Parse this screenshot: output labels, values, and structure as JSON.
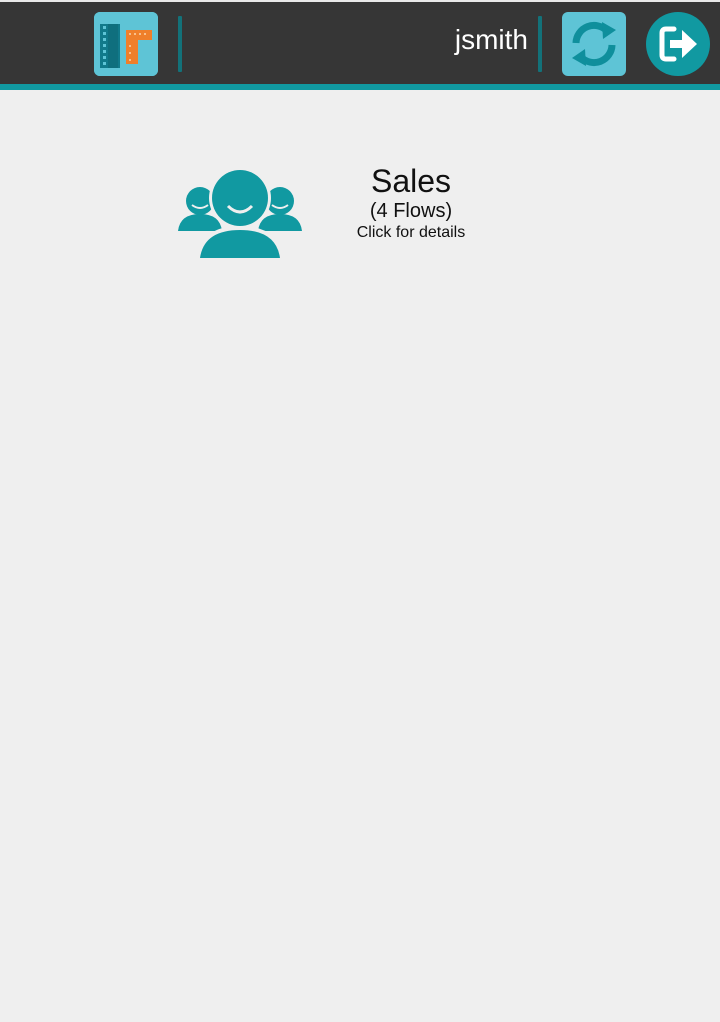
{
  "header": {
    "username": "jsmith",
    "logo_icon": "film-flow-app-icon",
    "refresh_icon": "refresh-icon",
    "logout_icon": "logout-icon",
    "colors": {
      "bar": "#363636",
      "accent": "#1199a1",
      "tile": "#5ec4d6",
      "logo_orange": "#ef7f2a"
    }
  },
  "group": {
    "name": "Sales",
    "flows_label": "(4 Flows)",
    "hint": "Click for details",
    "icon": "users-group-icon",
    "color": "#1199a1"
  }
}
